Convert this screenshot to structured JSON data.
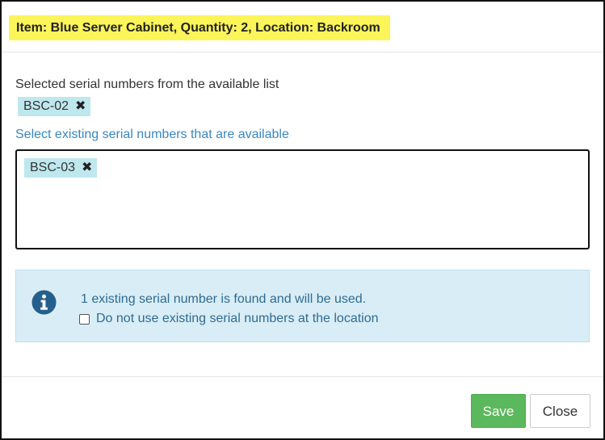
{
  "dialog": {
    "title": "Item: Blue Server Cabinet, Quantity: 2, Location: Backroom"
  },
  "selected": {
    "label": "Selected serial numbers from the available list",
    "tags": [
      "BSC-02"
    ],
    "remove_glyph": "✖"
  },
  "available": {
    "label": "Select existing serial numbers that are available",
    "tags": [
      "BSC-03"
    ],
    "remove_glyph": "✖"
  },
  "info": {
    "icon": "info-circle-icon",
    "message": "1 existing serial number is found and will be used.",
    "checkbox_label": "Do not use existing serial numbers at the location",
    "checkbox_checked": false
  },
  "footer": {
    "save_label": "Save",
    "close_label": "Close"
  },
  "colors": {
    "title_highlight": "#fbf55a",
    "tag_background": "#bfe7ee",
    "link_blue": "#3a87c0",
    "info_background": "#d9edf6",
    "info_icon": "#245f8d",
    "save_green": "#5cb85c"
  }
}
